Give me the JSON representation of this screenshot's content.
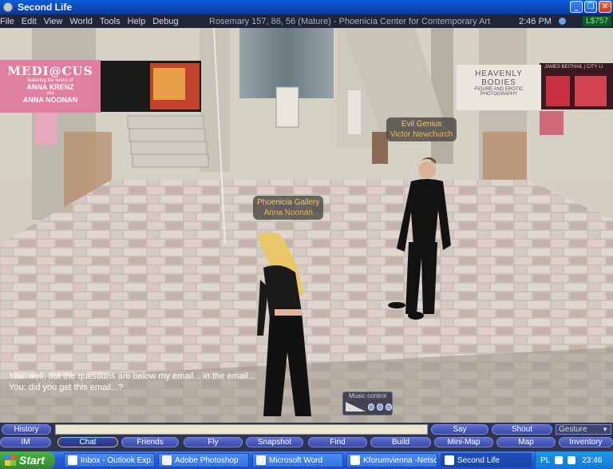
{
  "window": {
    "title": "Second Life",
    "buttons": {
      "minimize": "_",
      "maximize": "❐",
      "close": "✕"
    }
  },
  "menubar": {
    "items": [
      "File",
      "Edit",
      "View",
      "World",
      "Tools",
      "Help",
      "Debug"
    ],
    "region": "Rosemary 157, 86, 56 (Mature) - Phoenicia Center for Contemporary Art",
    "clock": "2:46 PM",
    "balance": "L$757"
  },
  "scene": {
    "nametags": [
      {
        "line1": "Evil Genius",
        "line2": "Victor Newchurch"
      },
      {
        "line1": "Phoenicia Gallery",
        "line2": "Anna Noonan"
      }
    ],
    "posters": {
      "medicus": {
        "title": "MEDI@CUS",
        "subtitle": "featuring the works of",
        "name1": "ANNA KRENZ",
        "aka": "aka",
        "name2": "ANNA NOONAN"
      },
      "bodies": {
        "title": "HEAVENLY BODIES",
        "subtitle": "FIGURE AND EROTIC PHOTOGRAPHY"
      },
      "right_banner": "JAMES BEITHAIL | CITY LI"
    }
  },
  "chat_log": [
    "You: well, but the questions are below my email... in the email...",
    "You: did you get this email...?"
  ],
  "music_control": {
    "label": "Music control"
  },
  "chatbar": {
    "history": "History",
    "say": "Say",
    "shout": "Shout",
    "gesture": "Gesture"
  },
  "toolbar": [
    "IM",
    "Chat",
    "Friends",
    "Fly",
    "Snapshot",
    "Find",
    "Build",
    "Mini-Map",
    "Map",
    "Inventory"
  ],
  "taskbar": {
    "start": "Start",
    "tasks": [
      "Inbox - Outlook Exp...",
      "Adobe Photoshop",
      "Microsoft Word",
      "Kforumvienna -Netsc...",
      "Second Life"
    ],
    "lang": "PL",
    "time": "23:46"
  },
  "colors": {
    "menubar": "#20253a",
    "button": "#4a5cc0",
    "taskbar": "#245edb",
    "tag_text": "#f5c46a"
  }
}
